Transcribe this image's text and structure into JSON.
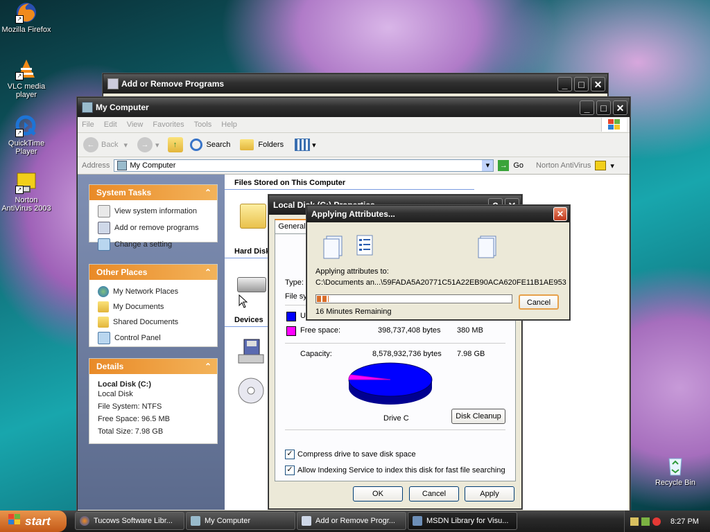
{
  "desktop": {
    "icons": [
      {
        "label": "Mozilla Firefox",
        "icon": "firefox-icon"
      },
      {
        "label": "VLC media player",
        "icon": "vlc-icon"
      },
      {
        "label": "QuickTime Player",
        "icon": "quicktime-icon"
      },
      {
        "label": "Norton AntiVirus 2003",
        "icon": "norton-icon"
      },
      {
        "label": "Recycle Bin",
        "icon": "recycle-bin-icon"
      }
    ]
  },
  "addremove_window": {
    "title": "Add or Remove Programs"
  },
  "mycomputer_window": {
    "title": "My Computer",
    "menu": [
      "File",
      "Edit",
      "View",
      "Favorites",
      "Tools",
      "Help"
    ],
    "toolbar": {
      "back": "Back",
      "search": "Search",
      "folders": "Folders"
    },
    "address": {
      "label": "Address",
      "value": "My Computer",
      "go": "Go",
      "norton": "Norton AntiVirus"
    },
    "system_tasks": {
      "title": "System Tasks",
      "items": [
        "View system information",
        "Add or remove programs",
        "Change a setting"
      ]
    },
    "other_places": {
      "title": "Other Places",
      "items": [
        "My Network Places",
        "My Documents",
        "Shared Documents",
        "Control Panel"
      ]
    },
    "details": {
      "title": "Details",
      "name": "Local Disk (C:)",
      "type": "Local Disk",
      "fs": "File System: NTFS",
      "free": "Free Space: 96.5 MB",
      "total": "Total Size: 7.98 GB"
    },
    "sections": {
      "files": "Files Stored on This Computer",
      "hard": "Hard Disk",
      "devices": "Devices"
    }
  },
  "properties_dialog": {
    "title": "Local Disk (C:) Properties",
    "tab": "General",
    "type_label": "Type:",
    "fs_label": "File sys",
    "used_label": "U",
    "free_label": "Free space:",
    "free_bytes": "398,737,408 bytes",
    "free_mb": "380 MB",
    "capacity_label": "Capacity:",
    "capacity_bytes": "8,578,932,736 bytes",
    "capacity_gb": "7.98 GB",
    "drive_label": "Drive C",
    "cleanup": "Disk Cleanup",
    "compress": "Compress drive to save disk space",
    "indexing": "Allow Indexing Service to index this disk for fast file searching",
    "ok": "OK",
    "cancel": "Cancel",
    "apply": "Apply",
    "used_color": "#0000ff",
    "free_color": "#ff00ff",
    "used_fraction": 0.953
  },
  "applying_dialog": {
    "title": "Applying Attributes...",
    "label": "Applying attributes to:",
    "path": "C:\\Documents an...\\59FADA5A20771C51A22EB90ACA620FE11B1AE953",
    "progress": 0.06,
    "remaining": "16 Minutes Remaining",
    "cancel": "Cancel"
  },
  "taskbar": {
    "start": "start",
    "tasks": [
      "Tucows Software Libr...",
      "My Computer",
      "Add or Remove Progr...",
      "MSDN Library for Visu..."
    ],
    "time": "8:27 PM"
  }
}
